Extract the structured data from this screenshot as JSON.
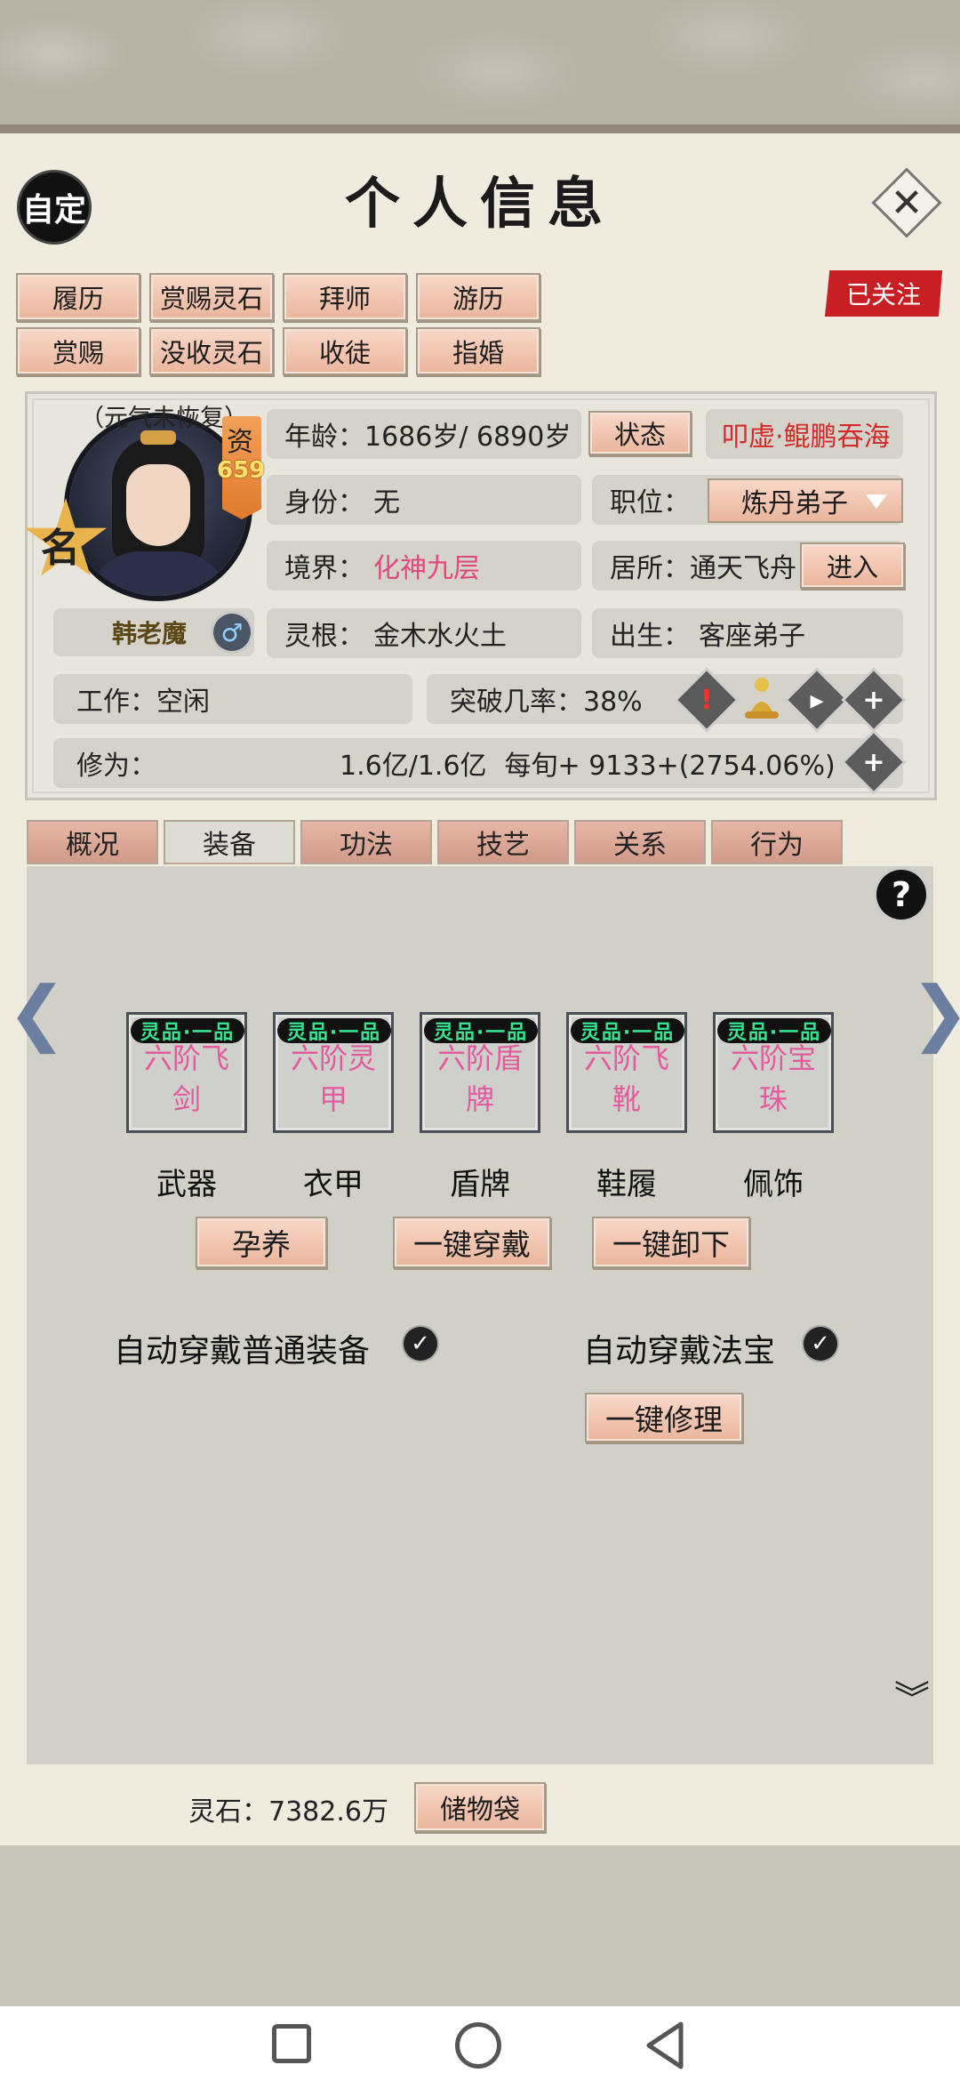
{
  "header": {
    "title": "个人信息",
    "auto_label": "自定",
    "close_glyph": "✕",
    "follow_label": "已关注"
  },
  "actions": {
    "row1": [
      "履历",
      "赏赐灵石",
      "拜师",
      "游历"
    ],
    "row2": [
      "赏赐",
      "没收灵石",
      "收徒",
      "指婚"
    ]
  },
  "profile": {
    "status_note": "（元气未恢复）",
    "zi_label": "资",
    "zi_value": "659",
    "rank_char": "名",
    "name": "韩老魔",
    "gender_glyph": "♂",
    "age": "年龄：1686岁/ 6890岁",
    "status_button": "状态",
    "sect_text": "叩虚·鲲鹏吞海",
    "identity_label": "身份：",
    "identity_value": "无",
    "position_label": "职位：",
    "position_value": "炼丹弟子",
    "realm_label": "境界：",
    "realm_value": "化神九层",
    "residence": "居所：通天飞舟",
    "enter_button": "进入",
    "root_label": "灵根：",
    "root_value": "金木水火土",
    "birth_label": "出生：",
    "birth_value": "客座弟子",
    "work": "工作：空闲",
    "breakthrough": "突破几率：38%",
    "cultivation_label": "修为：",
    "cultivation_value": "1.6亿/1.6亿",
    "per_turn": "每旬+  9133+(2754.06%)"
  },
  "tabs": [
    "概况",
    "装备",
    "功法",
    "技艺",
    "关系",
    "行为"
  ],
  "active_tab": "装备",
  "equipment": {
    "grade": "灵品·一品",
    "slots": [
      {
        "item": "六阶飞剑",
        "line1": "六阶飞",
        "line2": "剑",
        "label": "武器"
      },
      {
        "item": "六阶灵甲",
        "line1": "六阶灵",
        "line2": "甲",
        "label": "衣甲"
      },
      {
        "item": "六阶盾牌",
        "line1": "六阶盾",
        "line2": "牌",
        "label": "盾牌"
      },
      {
        "item": "六阶飞靴",
        "line1": "六阶飞",
        "line2": "靴",
        "label": "鞋履"
      },
      {
        "item": "六阶宝珠",
        "line1": "六阶宝",
        "line2": "珠",
        "label": "佩饰"
      }
    ],
    "nurture_button": "孕养",
    "equip_all_button": "一键穿戴",
    "unequip_all_button": "一键卸下",
    "auto_normal_label": "自动穿戴普通装备",
    "auto_treasure_label": "自动穿戴法宝",
    "repair_button": "一键修理",
    "help_glyph": "?",
    "left_arrow": "❮",
    "right_arrow": "❯",
    "collapse_glyph": "︾"
  },
  "footer": {
    "lingshi": "灵石：7382.6万",
    "bag_button": "储物袋"
  },
  "colors": {
    "accent_button": "#eab59c",
    "follow_red": "#c81f24",
    "pink_text": "#e0497f",
    "grade_green": "#37e38f"
  }
}
